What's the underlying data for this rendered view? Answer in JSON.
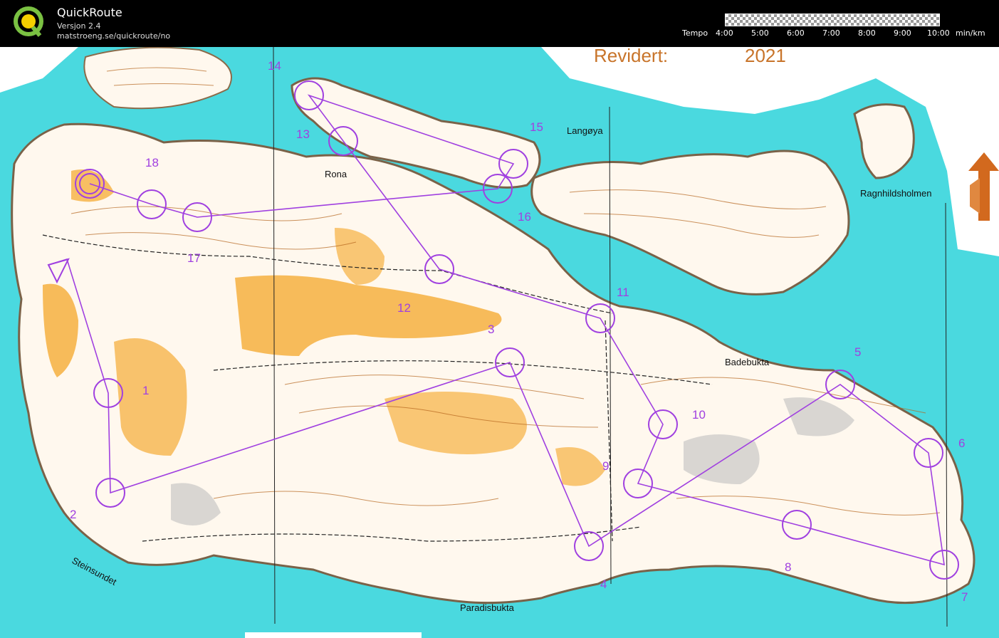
{
  "app": {
    "title": "QuickRoute",
    "version": "Versjon 2.4",
    "url": "matstroeng.se/quickroute/no"
  },
  "tempo": {
    "label": "Tempo",
    "ticks": [
      "4:00",
      "5:00",
      "6:00",
      "7:00",
      "8:00",
      "9:00",
      "10:00"
    ],
    "unit": "min/km"
  },
  "map": {
    "revision_label": "Revidert:",
    "revision_year": "2021",
    "place_names": {
      "langoya": "Langøya",
      "rona": "Rona",
      "badebukta": "Badebukta",
      "ragnhildsholmen": "Ragnhildsholmen",
      "steinsundet": "Steinsundet",
      "paradisbukta": "Paradisbukta"
    },
    "controls": [
      "1",
      "2",
      "3",
      "4",
      "5",
      "6",
      "7",
      "8",
      "9",
      "10",
      "11",
      "12",
      "13",
      "14",
      "15",
      "16",
      "17",
      "18"
    ]
  },
  "colors": {
    "water": "#4ad9df",
    "land": "#fff8ee",
    "open_land": "#f6b040",
    "course": "#a040e0",
    "contour": "#b5651d",
    "north_arrow": "#d2691e"
  }
}
